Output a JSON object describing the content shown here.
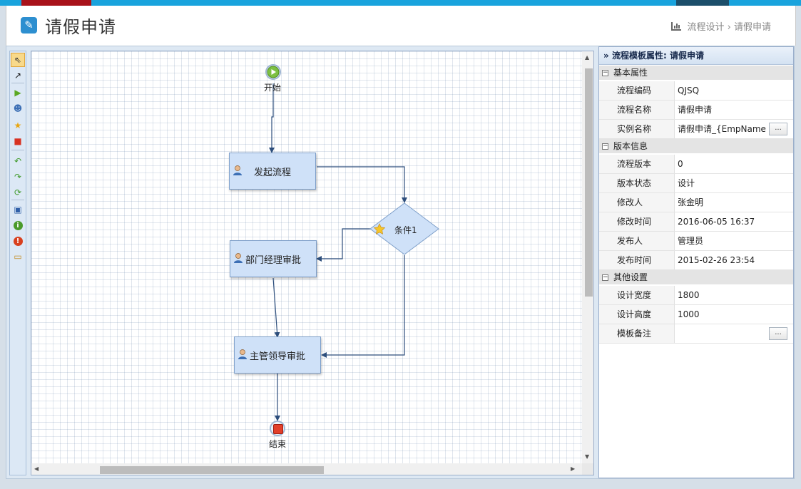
{
  "page": {
    "title": "请假申请",
    "breadcrumb": [
      "流程设计",
      "请假申请"
    ],
    "breadcrumb_separator": "›"
  },
  "toolbar": {
    "tools": [
      {
        "name": "pointer-icon",
        "glyph": "⇖",
        "active": true
      },
      {
        "name": "connector-arrow-icon",
        "glyph": "↗"
      },
      {
        "name": "start-event-icon",
        "glyph": "▶"
      },
      {
        "name": "user-task-icon",
        "glyph": "☻"
      },
      {
        "name": "condition-star-icon",
        "glyph": "★"
      },
      {
        "name": "end-event-icon",
        "glyph": "■"
      },
      {
        "name": "undo-icon",
        "glyph": "↶"
      },
      {
        "name": "redo-icon",
        "glyph": "↷"
      },
      {
        "name": "refresh-icon",
        "glyph": "⟳"
      },
      {
        "name": "save-icon",
        "glyph": "▣"
      },
      {
        "name": "info-icon",
        "glyph": "i"
      },
      {
        "name": "warning-icon",
        "glyph": "!"
      },
      {
        "name": "open-folder-icon",
        "glyph": "▭"
      }
    ]
  },
  "diagram": {
    "start_label": "开始",
    "end_label": "结束",
    "tasks": {
      "initiate": "发起流程",
      "dept_manager": "部门经理审批",
      "supervisor": "主管领导审批"
    },
    "condition_label": "条件1"
  },
  "properties": {
    "title_prefix": "流程模板属性:",
    "title_name": "请假申请",
    "groups": [
      {
        "label": "基本属性",
        "rows": [
          {
            "name": "流程编码",
            "value": "QJSQ",
            "button": false
          },
          {
            "name": "流程名称",
            "value": "请假申请",
            "button": false
          },
          {
            "name": "实例名称",
            "value": "请假申请_{EmpName",
            "button": true
          }
        ]
      },
      {
        "label": "版本信息",
        "rows": [
          {
            "name": "流程版本",
            "value": "0",
            "button": false
          },
          {
            "name": "版本状态",
            "value": "设计",
            "button": false
          },
          {
            "name": "修改人",
            "value": "张金明",
            "button": false
          },
          {
            "name": "修改时间",
            "value": "2016-06-05 16:37",
            "button": false
          },
          {
            "name": "发布人",
            "value": "管理员",
            "button": false
          },
          {
            "name": "发布时间",
            "value": "2015-02-26 23:54",
            "button": false
          }
        ]
      },
      {
        "label": "其他设置",
        "rows": [
          {
            "name": "设计宽度",
            "value": "1800",
            "button": false
          },
          {
            "name": "设计高度",
            "value": "1000",
            "button": false
          },
          {
            "name": "模板备注",
            "value": "",
            "button": true
          }
        ]
      }
    ],
    "ellipsis_label": "...",
    "collapse_glyph": "−"
  },
  "colors": {
    "accent_top": "#19a3dd",
    "accent_red": "#a8121a",
    "node_fill": "#cfe1f8",
    "connector": "#2d4e7c"
  }
}
